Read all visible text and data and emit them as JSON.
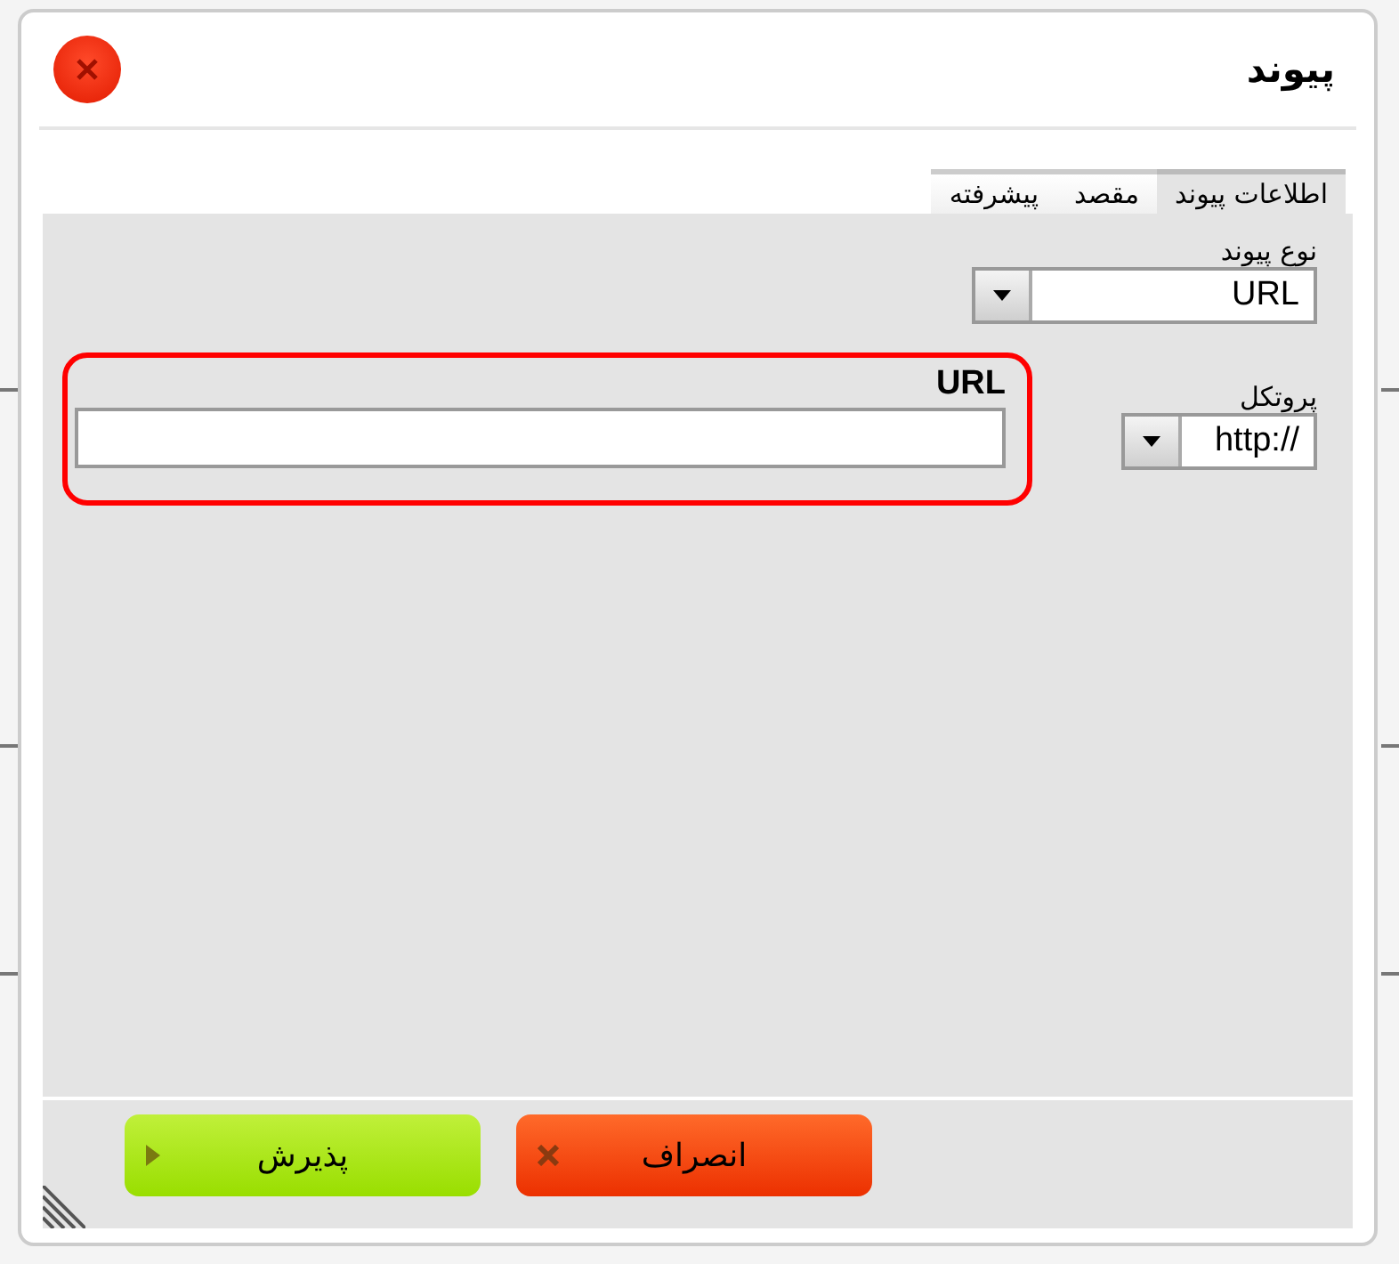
{
  "dialog": {
    "title": "پیوند"
  },
  "tabs": [
    {
      "label": "اطلاعات پیوند",
      "selected": true
    },
    {
      "label": "مقصد",
      "selected": false
    },
    {
      "label": "پیشرفته",
      "selected": false
    }
  ],
  "link_type": {
    "label": "نوع پیوند",
    "value": "URL"
  },
  "protocol": {
    "label": "پروتکل",
    "value": "http://"
  },
  "url": {
    "label": "URL",
    "highlighted": true
  },
  "buttons": [
    {
      "label": "انصراف",
      "kind": "cancel"
    },
    {
      "label": "پذیرش",
      "kind": "ok"
    }
  ]
}
